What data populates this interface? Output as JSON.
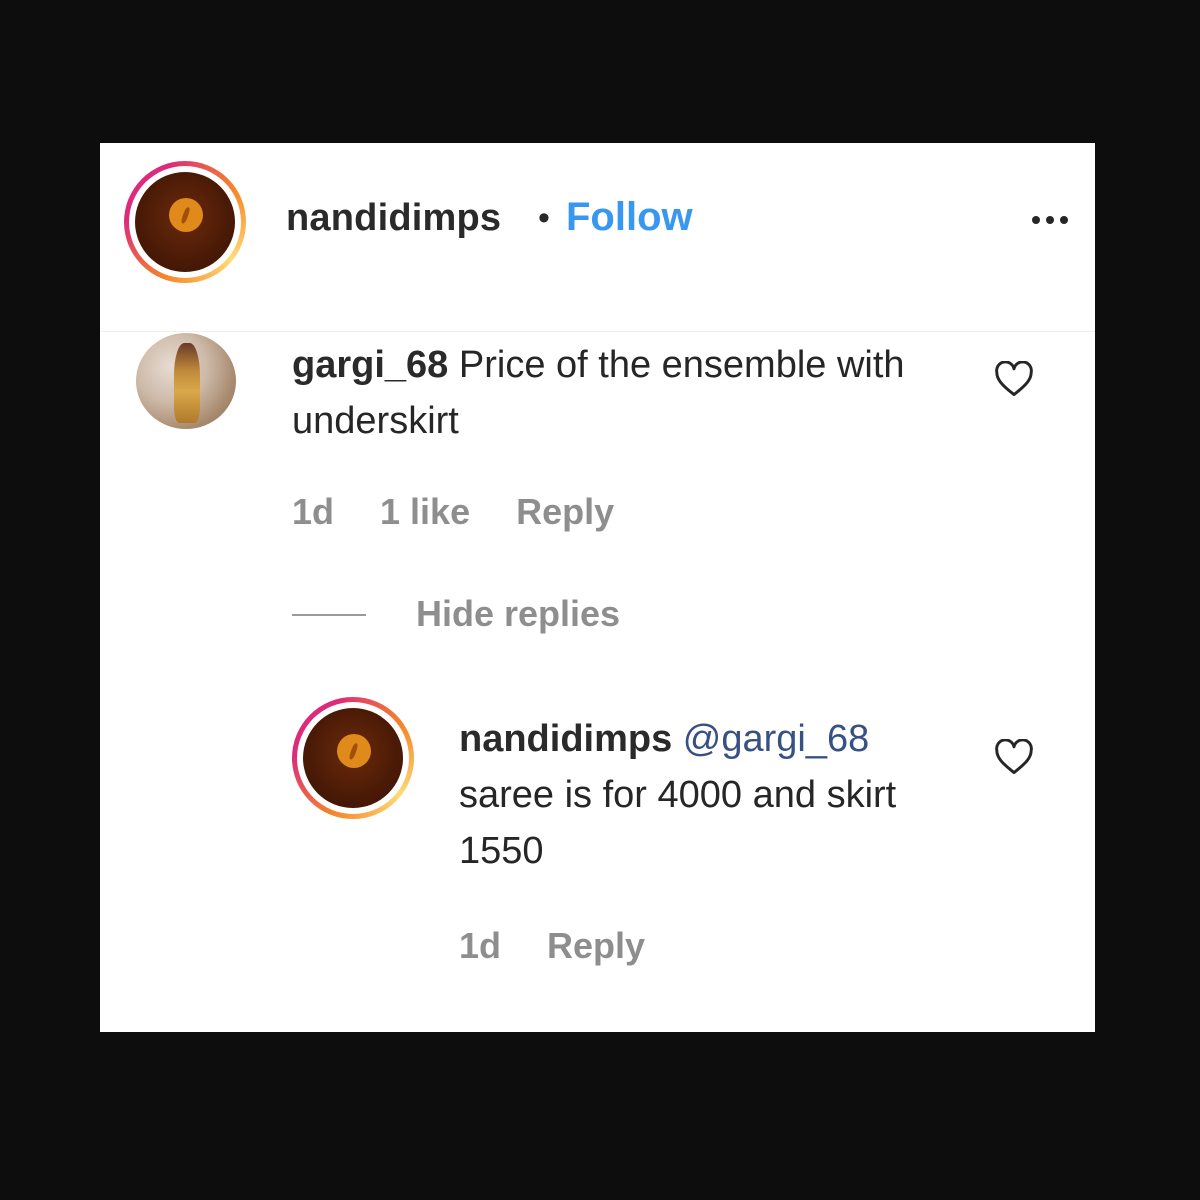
{
  "header": {
    "username": "nandidimps",
    "separator": "•",
    "follow_label": "Follow",
    "more_icon": "more-horizontal-icon"
  },
  "comment": {
    "username": "gargi_68",
    "text": "Price of the ensemble with underskirt",
    "time": "1d",
    "likes": "1 like",
    "reply_label": "Reply",
    "like_icon": "heart-icon"
  },
  "replies_toggle": {
    "label": "Hide replies"
  },
  "reply": {
    "username": "nandidimps",
    "mention": "@gargi_68",
    "text": "saree is for 4000 and skirt 1550",
    "time": "1d",
    "reply_label": "Reply",
    "like_icon": "heart-icon"
  },
  "colors": {
    "follow": "#3897f0",
    "mention": "#385185",
    "meta": "#8e8e8e",
    "background": "#0d0d0d"
  }
}
